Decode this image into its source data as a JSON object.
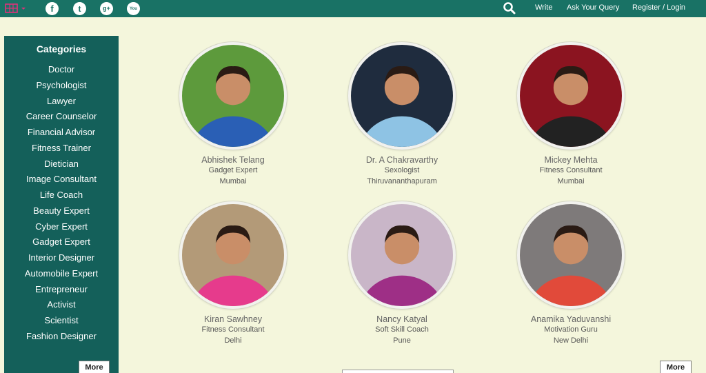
{
  "colors": {
    "topbar": "#197265",
    "sidebar": "#14605a",
    "background": "#f4f6dc"
  },
  "header": {
    "logo_icon": "grid-logo-icon",
    "social": [
      {
        "icon": "facebook-icon",
        "glyph": "f"
      },
      {
        "icon": "twitter-icon",
        "glyph": "t"
      },
      {
        "icon": "google-plus-icon",
        "glyph": "g+"
      },
      {
        "icon": "youtube-icon",
        "glyph": "You"
      }
    ],
    "search_icon": "search-icon",
    "nav": {
      "write": "Write",
      "ask": "Ask Your Query",
      "register": "Register / Login"
    }
  },
  "sidebar": {
    "title": "Categories",
    "items": [
      "Doctor",
      "Psychologist",
      "Lawyer",
      "Career Counselor",
      "Financial Advisor",
      "Fitness Trainer",
      "Dietician",
      "Image Consultant",
      "Life Coach",
      "Beauty Expert",
      "Cyber Expert",
      "Gadget Expert",
      "Interior Designer",
      "Automobile Expert",
      "Entrepreneur",
      "Activist",
      "Scientist",
      "Fashion Designer"
    ],
    "more_label": "More"
  },
  "experts": [
    {
      "name": "Abhishek Telang",
      "role": "Gadget Expert",
      "city": "Mumbai",
      "palette": [
        "#5d9a3c",
        "#2a5fb5"
      ]
    },
    {
      "name": "Dr. A Chakravarthy",
      "role": "Sexologist",
      "city": "Thiruvananthapuram",
      "palette": [
        "#1f2c3e",
        "#8ec3e4"
      ]
    },
    {
      "name": "Mickey Mehta",
      "role": "Fitness Consultant",
      "city": "Mumbai",
      "palette": [
        "#8b1420",
        "#222222"
      ]
    },
    {
      "name": "Kiran Sawhney",
      "role": "Fitness Consultant",
      "city": "Delhi",
      "palette": [
        "#b39a78",
        "#e63b8c"
      ]
    },
    {
      "name": "Nancy Katyal",
      "role": "Soft Skill Coach",
      "city": "Pune",
      "palette": [
        "#c9b6c8",
        "#9e2f86"
      ]
    },
    {
      "name": "Anamika Yaduvanshi",
      "role": "Motivation Guru",
      "city": "New Delhi",
      "palette": [
        "#7e7a7a",
        "#e14a3a"
      ]
    }
  ],
  "main_more_label": "More"
}
